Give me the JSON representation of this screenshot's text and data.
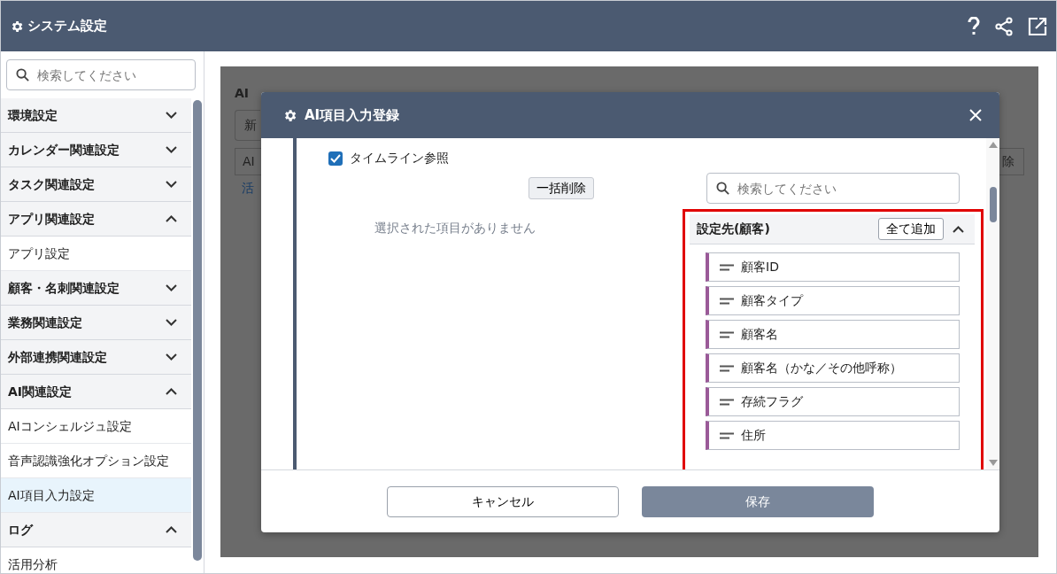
{
  "header": {
    "title": "システム設定"
  },
  "sidebar": {
    "search": {
      "placeholder": "検索してください"
    },
    "groups": [
      {
        "label": "環境設定",
        "expanded": false
      },
      {
        "label": "カレンダー関連設定",
        "expanded": false
      },
      {
        "label": "タスク関連設定",
        "expanded": false
      },
      {
        "label": "アプリ関連設定",
        "expanded": true,
        "children": [
          {
            "label": "アプリ設定",
            "selected": false
          }
        ]
      },
      {
        "label": "顧客・名刺関連設定",
        "expanded": false
      },
      {
        "label": "業務関連設定",
        "expanded": false
      },
      {
        "label": "外部連携関連設定",
        "expanded": false
      },
      {
        "label": "AI関連設定",
        "expanded": true,
        "children": [
          {
            "label": "AIコンシェルジュ設定",
            "selected": false
          },
          {
            "label": "音声認識強化オプション設定",
            "selected": false
          },
          {
            "label": "AI項目入力設定",
            "selected": true
          }
        ]
      },
      {
        "label": "ログ",
        "expanded": true,
        "children": [
          {
            "label": "活用分析",
            "selected": false
          }
        ]
      }
    ]
  },
  "background_page": {
    "title": "AI",
    "button": "新",
    "column_1": "AI",
    "column_2": "除",
    "cell": "活"
  },
  "modal": {
    "title": "AI項目入力登録",
    "timeline": {
      "label": "タイムライン参照",
      "checked": true
    },
    "bulk_delete": "一括削除",
    "empty_message": "選択された項目がありません",
    "search": {
      "placeholder": "検索してください"
    },
    "group": {
      "title": "設定先(顧客)",
      "add_all": "全て追加",
      "expanded": true,
      "fields": [
        {
          "label": "顧客ID"
        },
        {
          "label": "顧客タイプ"
        },
        {
          "label": "顧客名"
        },
        {
          "label": "顧客名（かな／その他呼称）"
        },
        {
          "label": "存続フラグ"
        },
        {
          "label": "住所"
        }
      ]
    },
    "buttons": {
      "cancel": "キャンセル",
      "save": "保存"
    }
  }
}
